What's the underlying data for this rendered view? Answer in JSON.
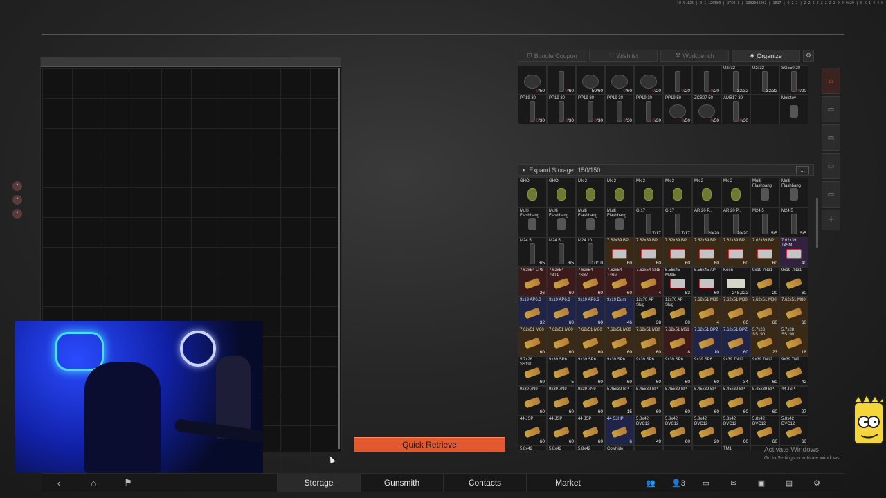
{
  "build_info": "10.0.125 | 0 1 1205B0 | UTCO 1 | 1092902202 | 1017 | 6 2 1 | 2 2 2 2 2 2 2 2 0 0 0e29 | 0 K 1 4 4 0",
  "quick_retrieve_label": "Quick Retrieve",
  "top_tabs": [
    {
      "label": "Bundle Coupon",
      "icon": "coupon-icon"
    },
    {
      "label": "Wishlist",
      "icon": "heart-icon"
    },
    {
      "label": "Workbench",
      "icon": "wrench-icon"
    },
    {
      "label": "Organize",
      "icon": "organize-icon"
    }
  ],
  "storage": {
    "label": "Expand Storage",
    "capacity": "150/150",
    "more": "..."
  },
  "upper_items": [
    {
      "name": "",
      "count": "0/50",
      "red": "0",
      "ico": "round"
    },
    {
      "name": "",
      "count": "0/60",
      "red": "0",
      "ico": "mag"
    },
    {
      "name": "",
      "count": "50/60",
      "red": "",
      "ico": "round"
    },
    {
      "name": "",
      "count": "0/60",
      "red": "0",
      "ico": "round"
    },
    {
      "name": "",
      "count": "0/20",
      "red": "0",
      "ico": "round"
    },
    {
      "name": "",
      "count": "0/20",
      "red": "0",
      "ico": "mag"
    },
    {
      "name": "",
      "count": "0/20",
      "red": "0",
      "ico": "mag"
    },
    {
      "name": "Uzi 32",
      "count": "32/32",
      "red": "",
      "ico": "mag"
    },
    {
      "name": "Uzi 32",
      "count": "32/32",
      "red": "",
      "ico": "mag"
    },
    {
      "name": "SG550 20",
      "count": "0/20",
      "red": "0",
      "ico": "mag"
    },
    {
      "name": "PP19 30",
      "count": "0/30",
      "red": "0",
      "ico": "mag"
    },
    {
      "name": "PP19 30",
      "count": "0/30",
      "red": "0",
      "ico": "mag"
    },
    {
      "name": "PP19 30",
      "count": "0/30",
      "red": "0",
      "ico": "mag"
    },
    {
      "name": "PP19 30",
      "count": "0/30",
      "red": "0",
      "ico": "mag"
    },
    {
      "name": "PP19 30",
      "count": "0/30",
      "red": "0",
      "ico": "mag"
    },
    {
      "name": "PP19 50",
      "count": "0/50",
      "red": "0",
      "ico": "round"
    },
    {
      "name": "ZCB07 50",
      "count": "0/50",
      "red": "0",
      "ico": "round"
    },
    {
      "name": "AMB17 30",
      "count": "0/30",
      "red": "0",
      "ico": "mag"
    },
    {
      "name": "",
      "count": "",
      "red": "",
      "ico": "none"
    },
    {
      "name": "Molotov",
      "count": "",
      "red": "",
      "ico": "flash"
    }
  ],
  "storage_items": [
    {
      "name": "GHO",
      "count": "",
      "bg": "",
      "ico": "gren"
    },
    {
      "name": "GHO",
      "count": "",
      "bg": "",
      "ico": "gren"
    },
    {
      "name": "Mk 2",
      "count": "",
      "bg": "",
      "ico": "gren"
    },
    {
      "name": "Mk 2",
      "count": "",
      "bg": "",
      "ico": "gren"
    },
    {
      "name": "Mk 2",
      "count": "",
      "bg": "",
      "ico": "gren"
    },
    {
      "name": "Mk 2",
      "count": "",
      "bg": "",
      "ico": "gren"
    },
    {
      "name": "Mk 2",
      "count": "",
      "bg": "",
      "ico": "gren"
    },
    {
      "name": "Mk 2",
      "count": "",
      "bg": "",
      "ico": "gren"
    },
    {
      "name": "Multi Flashbang",
      "count": "",
      "bg": "",
      "ico": "flash"
    },
    {
      "name": "Multi Flashbang",
      "count": "",
      "bg": "",
      "ico": "flash"
    },
    {
      "name": "Multi Flashbang",
      "count": "",
      "bg": "",
      "ico": "flash"
    },
    {
      "name": "Multi Flashbang",
      "count": "",
      "bg": "",
      "ico": "flash"
    },
    {
      "name": "Multi Flashbang",
      "count": "",
      "bg": "",
      "ico": "flash"
    },
    {
      "name": "Multi Flashbang",
      "count": "",
      "bg": "",
      "ico": "flash"
    },
    {
      "name": "G 17",
      "count": "17/17",
      "bg": "",
      "ico": "mag"
    },
    {
      "name": "G 17",
      "count": "17/17",
      "bg": "",
      "ico": "mag"
    },
    {
      "name": "AR 20 P...",
      "count": "20/20",
      "bg": "",
      "ico": "mag"
    },
    {
      "name": "AR 20 P...",
      "count": "20/20",
      "bg": "",
      "ico": "mag"
    },
    {
      "name": "M24 5",
      "count": "5/5",
      "bg": "",
      "ico": "mag"
    },
    {
      "name": "M24 5",
      "count": "5/5",
      "bg": "",
      "ico": "mag"
    },
    {
      "name": "M24 5",
      "count": "3/5",
      "bg": "",
      "ico": "mag"
    },
    {
      "name": "M24 5",
      "count": "3/5",
      "bg": "",
      "ico": "mag"
    },
    {
      "name": "M24 10",
      "count": "10/10",
      "bg": "",
      "ico": "mag"
    },
    {
      "name": "7.62x39 BP",
      "count": "60",
      "bg": "brown",
      "ico": "ammored"
    },
    {
      "name": "7.62x39 BP",
      "count": "60",
      "bg": "brown",
      "ico": "ammored"
    },
    {
      "name": "7.62x39 BP",
      "count": "60",
      "bg": "brown",
      "ico": "ammored"
    },
    {
      "name": "7.62x39 BP",
      "count": "60",
      "bg": "brown",
      "ico": "ammored"
    },
    {
      "name": "7.62x39 BP",
      "count": "60",
      "bg": "brown",
      "ico": "ammored"
    },
    {
      "name": "7.62x39 BP",
      "count": "60",
      "bg": "brown",
      "ico": "ammored"
    },
    {
      "name": "7.62x39 T45M",
      "count": "40",
      "bg": "purple",
      "ico": "ammored"
    },
    {
      "name": "7.62x54 LPS",
      "count": "26",
      "bg": "red",
      "ico": "ammo"
    },
    {
      "name": "7.62x54 7BT1",
      "count": "60",
      "bg": "red",
      "ico": "ammo"
    },
    {
      "name": "7.62x54 7N37",
      "count": "60",
      "bg": "red",
      "ico": "ammo"
    },
    {
      "name": "7.62x54 T46M",
      "count": "60",
      "bg": "red",
      "ico": "ammo"
    },
    {
      "name": "7.62x54 SNB",
      "count": "4",
      "bg": "red",
      "ico": "ammo"
    },
    {
      "name": "5.56x45 M995",
      "count": "53",
      "bg": "",
      "ico": "ammored"
    },
    {
      "name": "5.56x45 AP",
      "count": "60",
      "bg": "",
      "ico": "ammored"
    },
    {
      "name": "Koen",
      "count": "248,922",
      "bg": "",
      "ico": "cash"
    },
    {
      "name": "9x19 7N31",
      "count": "20",
      "bg": "",
      "ico": "ammo"
    },
    {
      "name": "9x19 7N31",
      "count": "60",
      "bg": "",
      "ico": "ammo"
    },
    {
      "name": "9x19 AP6.3",
      "count": "32",
      "bg": "navy",
      "ico": "ammo"
    },
    {
      "name": "9x19 AP6.3",
      "count": "60",
      "bg": "navy",
      "ico": "ammo"
    },
    {
      "name": "9x19 AP6.3",
      "count": "60",
      "bg": "navy",
      "ico": "ammo"
    },
    {
      "name": "9x19 Dum",
      "count": "46",
      "bg": "navy",
      "ico": "ammo"
    },
    {
      "name": "12x70 AP Slug",
      "count": "38",
      "bg": "",
      "ico": "ammo"
    },
    {
      "name": "12x70 AP Slug",
      "count": "60",
      "bg": "",
      "ico": "ammo"
    },
    {
      "name": "7.62x51 M80",
      "count": "4",
      "bg": "brown",
      "ico": "ammo"
    },
    {
      "name": "7.62x51 M80",
      "count": "60",
      "bg": "brown",
      "ico": "ammo"
    },
    {
      "name": "7.62x51 M80",
      "count": "60",
      "bg": "brown",
      "ico": "ammo"
    },
    {
      "name": "7.62x51 M80",
      "count": "60",
      "bg": "brown",
      "ico": "ammo"
    },
    {
      "name": "7.62x51 M80",
      "count": "60",
      "bg": "brown",
      "ico": "ammo"
    },
    {
      "name": "7.62x51 M80",
      "count": "60",
      "bg": "brown",
      "ico": "ammo"
    },
    {
      "name": "7.62x51 M80",
      "count": "60",
      "bg": "brown",
      "ico": "ammo"
    },
    {
      "name": "7.62x51 M80",
      "count": "60",
      "bg": "brown",
      "ico": "ammo"
    },
    {
      "name": "7.62x51 M80",
      "count": "60",
      "bg": "brown",
      "ico": "ammo"
    },
    {
      "name": "7.62x51 M61",
      "count": "8",
      "bg": "red",
      "ico": "ammo"
    },
    {
      "name": "7.62x51 BPZ",
      "count": "10",
      "bg": "navy",
      "ico": "ammo"
    },
    {
      "name": "7.62x51 BPZ",
      "count": "60",
      "bg": "navy",
      "ico": "ammo"
    },
    {
      "name": "5.7x28 SS190",
      "count": "23",
      "bg": "brown",
      "ico": "ammo"
    },
    {
      "name": "5.7x28 SS190",
      "count": "18",
      "bg": "brown",
      "ico": "ammo"
    },
    {
      "name": "5.7x28 SS190",
      "count": "60",
      "bg": "",
      "ico": "ammo"
    },
    {
      "name": "9x39 SP6",
      "count": "5",
      "bg": "",
      "ico": "ammo"
    },
    {
      "name": "9x39 SP6",
      "count": "60",
      "bg": "",
      "ico": "ammo"
    },
    {
      "name": "9x39 SP6",
      "count": "60",
      "bg": "",
      "ico": "ammo"
    },
    {
      "name": "9x39 SP6",
      "count": "60",
      "bg": "",
      "ico": "ammo"
    },
    {
      "name": "9x39 SP6",
      "count": "60",
      "bg": "",
      "ico": "ammo"
    },
    {
      "name": "9x39 SP6",
      "count": "60",
      "bg": "",
      "ico": "ammo"
    },
    {
      "name": "9x39 7N12",
      "count": "34",
      "bg": "",
      "ico": "ammo"
    },
    {
      "name": "9x39 7N12",
      "count": "60",
      "bg": "",
      "ico": "ammo"
    },
    {
      "name": "9x39 7N9",
      "count": "42",
      "bg": "",
      "ico": "ammo"
    },
    {
      "name": "9x39 7N9",
      "count": "60",
      "bg": "",
      "ico": "ammo"
    },
    {
      "name": "9x39 7N9",
      "count": "60",
      "bg": "",
      "ico": "ammo"
    },
    {
      "name": "9x39 7N9",
      "count": "60",
      "bg": "",
      "ico": "ammo"
    },
    {
      "name": "5.45x39 BP",
      "count": "15",
      "bg": "",
      "ico": "ammo"
    },
    {
      "name": "5.45x39 BP",
      "count": "60",
      "bg": "",
      "ico": "ammo"
    },
    {
      "name": "5.45x39 BP",
      "count": "60",
      "bg": "",
      "ico": "ammo"
    },
    {
      "name": "5.45x39 BP",
      "count": "60",
      "bg": "",
      "ico": "ammo"
    },
    {
      "name": "5.45x39 BP",
      "count": "60",
      "bg": "",
      "ico": "ammo"
    },
    {
      "name": "5.45x39 BP",
      "count": "60",
      "bg": "",
      "ico": "ammo"
    },
    {
      "name": "44 JSP",
      "count": "27",
      "bg": "",
      "ico": "ammo"
    },
    {
      "name": "44 JSP",
      "count": "60",
      "bg": "",
      "ico": "ammo"
    },
    {
      "name": "44 JSP",
      "count": "60",
      "bg": "",
      "ico": "ammo"
    },
    {
      "name": "44 JSP",
      "count": "60",
      "bg": "",
      "ico": "ammo"
    },
    {
      "name": "44 SJHP",
      "count": "6",
      "bg": "navy",
      "ico": "ammo"
    },
    {
      "name": "5.8x42 DVC12",
      "count": "49",
      "bg": "",
      "ico": "ammo"
    },
    {
      "name": "5.8x42 DVC12",
      "count": "60",
      "bg": "",
      "ico": "ammo"
    },
    {
      "name": "5.8x42 DVC12",
      "count": "20",
      "bg": "",
      "ico": "ammo"
    },
    {
      "name": "5.8x42 DVC12",
      "count": "60",
      "bg": "",
      "ico": "ammo"
    },
    {
      "name": "5.8x42 DVC12",
      "count": "60",
      "bg": "",
      "ico": "ammo"
    },
    {
      "name": "5.8x42 DVC12",
      "count": "60",
      "bg": "",
      "ico": "ammo"
    }
  ],
  "partial_row": [
    "5.8x42",
    "5.8x42",
    "5.8x42",
    "Cowhide",
    "",
    "",
    "",
    "TM1",
    "",
    ""
  ],
  "side_tabs": [
    "home-icon",
    "storage-1-icon",
    "storage-2-icon",
    "storage-3-icon",
    "storage-4-icon",
    "add-icon"
  ],
  "bottom_nav": {
    "tabs": [
      "Storage",
      "Gunsmith",
      "Contacts",
      "Market"
    ],
    "active": "Storage",
    "friends_count": "3"
  },
  "watermark": {
    "title": "Activate Windows",
    "sub": "Go to Settings to activate Windows."
  }
}
